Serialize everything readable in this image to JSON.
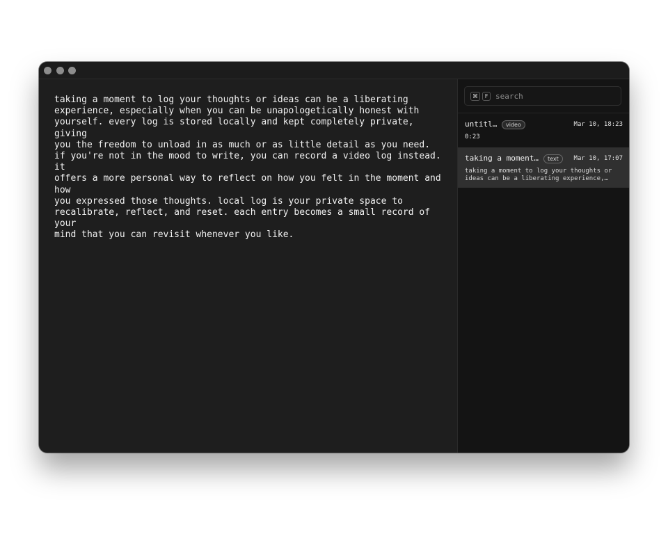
{
  "editor": {
    "paragraphs": [
      "taking a moment to log your thoughts or ideas can be a liberating\nexperience, especially when you can be unapologetically honest with\nyourself. every log is stored locally and kept completely private, giving\nyou the freedom to unload in as much or as little detail as you need.",
      "if you're not in the mood to write, you can record a video log instead. it\noffers a more personal way to reflect on how you felt in the moment and how\nyou expressed those thoughts. local log is your private space to\nrecalibrate, reflect, and reset. each entry becomes a small record of your\nmind that you can revisit whenever you like."
    ]
  },
  "search": {
    "shortcut_cmd": "⌘",
    "shortcut_key": "F",
    "placeholder": "search"
  },
  "entries": [
    {
      "title": "untitled",
      "badge": "video",
      "date": "Mar 10, 18:23",
      "duration": "0:23"
    },
    {
      "title": "taking a moment to log your thoughts or ideas",
      "badge": "text",
      "date": "Mar 10, 17:07",
      "preview": "taking a moment to log your thoughts or ideas can be a liberating experience, especially when you can be unapologetically honest with yourself.",
      "selected": true
    }
  ],
  "colors": {
    "editor_bg": "#1e1e1e",
    "sidebar_bg": "#141414",
    "selected_entry_bg": "#303030",
    "text": "#f2f2f2"
  }
}
